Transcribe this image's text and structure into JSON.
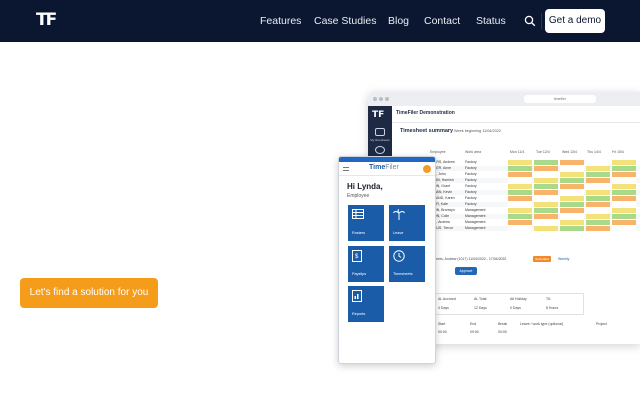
{
  "nav": {
    "logo": "TF",
    "links": [
      "Features",
      "Case Studies",
      "Blog",
      "Contact",
      "Status"
    ],
    "demo_label": "Get a demo"
  },
  "hero": {
    "cta_label": "Let's find a solution for you"
  },
  "desktop": {
    "url": "timefiler",
    "app_title": "TimeFiler Demonstration",
    "section_title": "Timesheet summary",
    "week_label": "Week beginning 11/04/2022",
    "sidebar": [
      "My timesheets",
      "Timesheets"
    ],
    "columns": [
      "Employee",
      "Work area",
      "Mon 11/4",
      "Tue 12/4",
      "Wed 13/4",
      "Thu 14/4",
      "Fri 15/4"
    ],
    "rows": [
      {
        "name": "ERS, Andrew",
        "area": "Factory"
      },
      {
        "name": "BER, Anne",
        "area": "Factory"
      },
      {
        "name": "S, John",
        "area": "Factory"
      },
      {
        "name": "IAN, Hamish",
        "area": "Factory"
      },
      {
        "name": "ON, Grant",
        "area": "Factory"
      },
      {
        "name": "HAN, Kevin",
        "area": "Factory"
      },
      {
        "name": "LAND, Karen",
        "area": "Factory"
      },
      {
        "name": "ER, Kate",
        "area": "Factory"
      },
      {
        "name": "ON, Bronwyn",
        "area": "Management"
      },
      {
        "name": "ON, Colin",
        "area": "Management"
      },
      {
        "name": "S, Andrew",
        "area": "Management"
      },
      {
        "name": "AUS, Trevor",
        "area": "Management"
      }
    ],
    "detail_name": "ners, Andrew (1017)  11/04/2022 - 17/04/2022",
    "badge": "Submitted",
    "weekly": "Weekly",
    "approve": "Approve",
    "leave_headers": [
      "AL Accrued",
      "AL Total",
      "Alt Holiday",
      "TIL"
    ],
    "leave_values": [
      "4 Days",
      "12 Days",
      "0 Days",
      "8 Hours"
    ],
    "shift_headers": [
      "Start",
      "End",
      "Break",
      "Leave / work type (optional)",
      "Project"
    ],
    "shift_values": [
      "00:00",
      "09:00",
      "00:00"
    ]
  },
  "phone": {
    "logo_main": "Time",
    "logo_sub": "Filer",
    "greeting": "Hi Lynda,",
    "role": "Employee",
    "tiles": [
      "Rosters",
      "Leave",
      "Payslips",
      "Timesheets",
      "Reports"
    ]
  },
  "colors": {
    "nav_bg": "#0b1630",
    "cta": "#f59d1a",
    "tile": "#1b5ca8",
    "cell_yellow": "#f3e27a",
    "cell_green": "#a9d98a",
    "cell_orange": "#f7b46a"
  }
}
